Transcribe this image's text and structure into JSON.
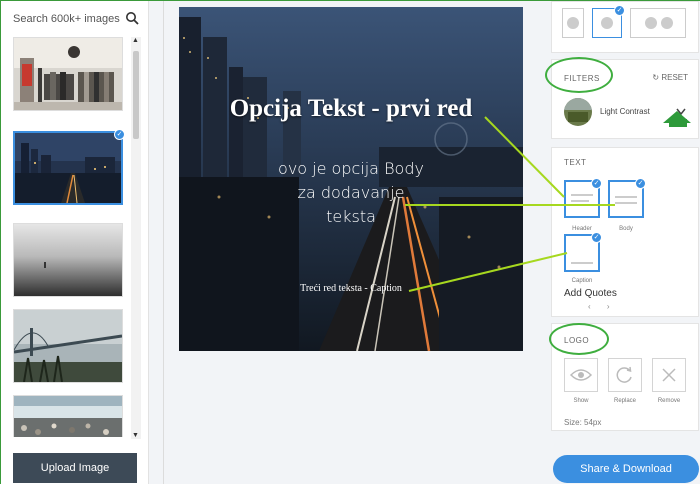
{
  "left_panel": {
    "search_placeholder": "Search 600k+ images",
    "upload_label": "Upload Image"
  },
  "canvas": {
    "header_text": "Opcija Tekst - prvi red",
    "body_text": "ovo je opcija Body za dodavanje teksta",
    "body_lines": [
      "ovo je opcija Body",
      "za dodavanje",
      "teksta"
    ],
    "caption_text": "Treći red teksta - Caption"
  },
  "right_panel": {
    "filters_title": "FILTERS",
    "reset_label": "RESET",
    "filter_selected": "Light Contrast",
    "text_title": "TEXT",
    "text_templates": [
      {
        "label": "Header",
        "selected": true
      },
      {
        "label": "Body",
        "selected": true
      },
      {
        "label": "Caption",
        "selected": true
      }
    ],
    "add_quotes_label": "Add Quotes",
    "logo_title": "LOGO",
    "logo_actions": [
      "Show",
      "Replace",
      "Remove"
    ],
    "size_label": "Size: 54px",
    "share_label": "Share & Download"
  },
  "colors": {
    "accent": "#3b8fe0",
    "annotation": "#3fae3f",
    "annotation_line": "#a6d81f",
    "dark_button": "#3d4a57"
  },
  "icons": [
    "search-icon",
    "check-icon",
    "refresh-icon",
    "chevron-down-icon",
    "arrow-right-icon",
    "eye-icon",
    "close-icon"
  ]
}
